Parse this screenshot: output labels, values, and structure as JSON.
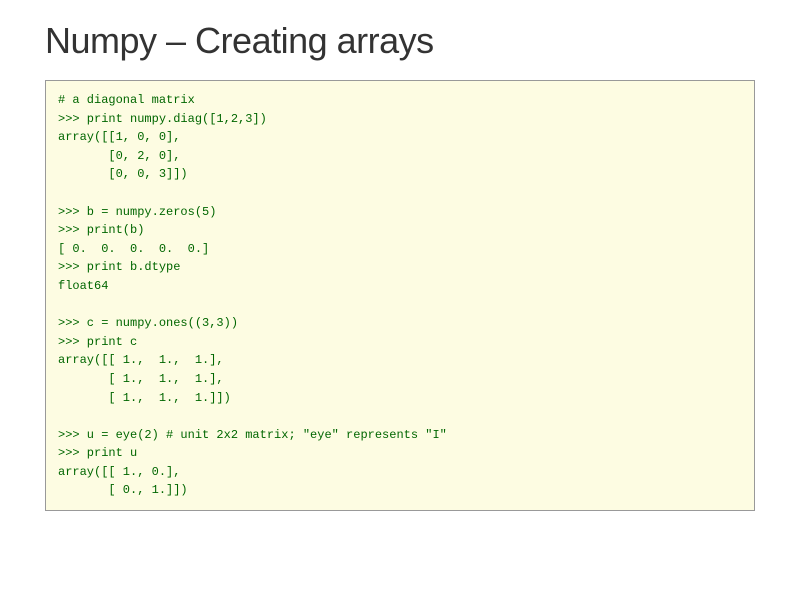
{
  "title": "Numpy – Creating arrays",
  "code": {
    "l1": "# a diagonal matrix",
    "l2": ">>> print numpy.diag([1,2,3])",
    "l3": "array([[1, 0, 0],",
    "l4": "       [0, 2, 0],",
    "l5": "       [0, 0, 3]])",
    "l6": "",
    "l7": ">>> b = numpy.zeros(5)",
    "l8": ">>> print(b)",
    "l9": "[ 0.  0.  0.  0.  0.]",
    "l10": ">>> print b.dtype",
    "l11": "float64",
    "l12": "",
    "l13": ">>> c = numpy.ones((3,3))",
    "l14": ">>> print c",
    "l15": "array([[ 1.,  1.,  1.],",
    "l16": "       [ 1.,  1.,  1.],",
    "l17": "       [ 1.,  1.,  1.]])",
    "l18": "",
    "l19": ">>> u = eye(2) # unit 2x2 matrix; \"eye\" represents \"I\"",
    "l20": ">>> print u",
    "l21": "array([[ 1., 0.],",
    "l22": "       [ 0., 1.]])"
  }
}
